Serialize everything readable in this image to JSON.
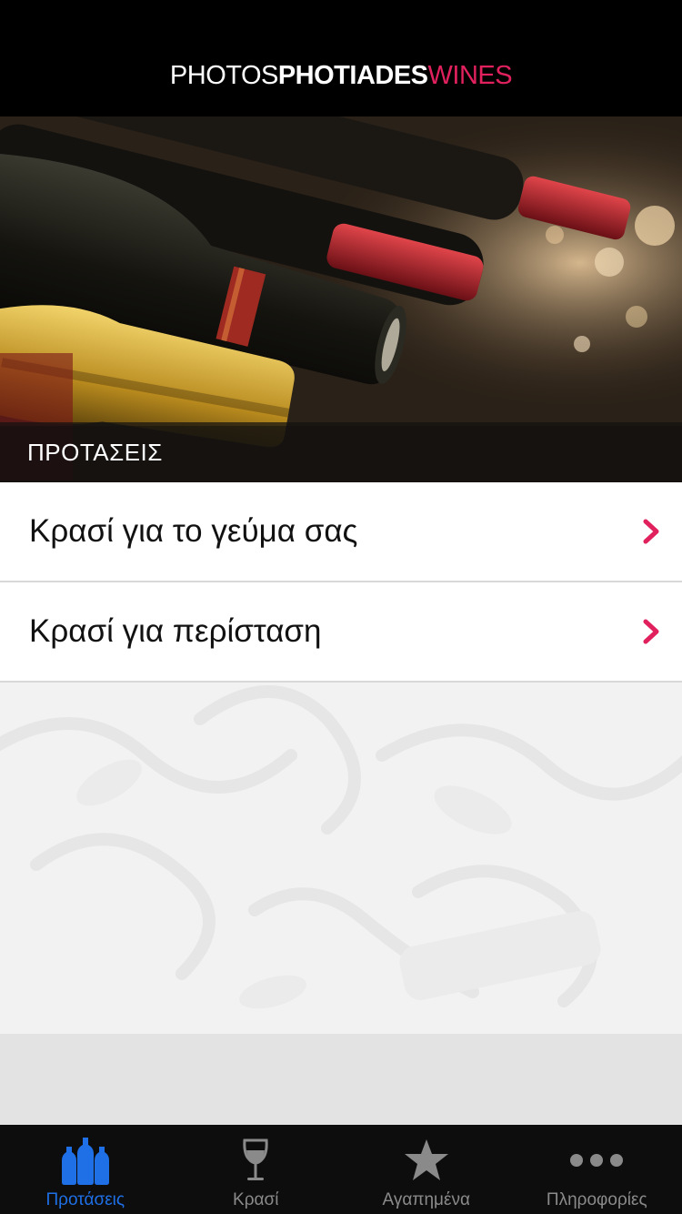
{
  "header": {
    "logo_part1": "PHOTOS",
    "logo_part2": "PHOTIADES",
    "logo_part3": "WINES",
    "logo_accent": "#e0215e"
  },
  "hero": {
    "caption": "ΠΡΟΤΑΣΕΙΣ"
  },
  "list": {
    "items": [
      {
        "label": "Κρασί για το γεύμα σας",
        "icon": "chevron-right-icon"
      },
      {
        "label": "Κρασί για περίσταση",
        "icon": "chevron-right-icon"
      }
    ]
  },
  "tabbar": {
    "active_color": "#1f6fe6",
    "tabs": [
      {
        "label": "Προτάσεις",
        "icon": "wine-bottles-icon",
        "active": true
      },
      {
        "label": "Κρασί",
        "icon": "wine-glass-icon",
        "active": false
      },
      {
        "label": "Αγαπημένα",
        "icon": "star-icon",
        "active": false
      },
      {
        "label": "Πληροφορίες",
        "icon": "more-dots-icon",
        "active": false
      }
    ]
  }
}
